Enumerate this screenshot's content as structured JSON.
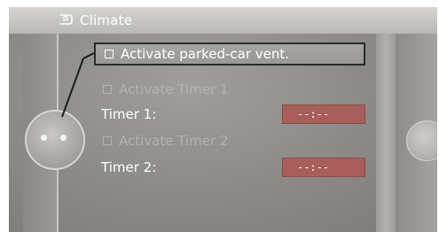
{
  "header": {
    "title": "Climate",
    "icon": "climate-fan-icon"
  },
  "menu": {
    "items": [
      {
        "label": "Activate parked-car vent.",
        "selected": true,
        "enabled": true,
        "checked": false
      },
      {
        "label": "Activate Timer 1",
        "selected": false,
        "enabled": false,
        "checked": false
      },
      {
        "label": "Activate Timer 2",
        "selected": false,
        "enabled": false,
        "checked": false
      }
    ],
    "timers": [
      {
        "label": "Timer 1:",
        "value": "--:--"
      },
      {
        "label": "Timer 2:",
        "value": "--:--"
      }
    ]
  },
  "colors": {
    "background": "#8f8d89",
    "header": "#c8c6c2",
    "text": "#ffffff",
    "disabled_text": "#b4b2ae",
    "timer_field": "#a85e5a",
    "selection_border": "#2b2b2b"
  },
  "controller": {
    "icon": "idrive-controller-icon"
  }
}
